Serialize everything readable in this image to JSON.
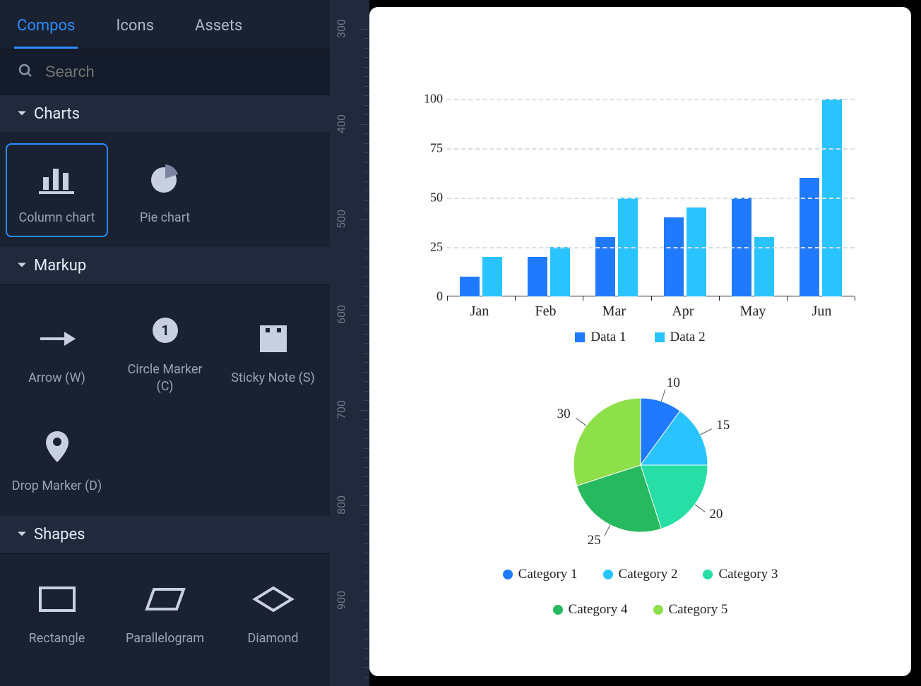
{
  "tabs": [
    "Compos",
    "Icons",
    "Assets"
  ],
  "active_tab": 0,
  "search": {
    "placeholder": "Search"
  },
  "sections": {
    "charts": {
      "title": "Charts",
      "items": [
        {
          "label": "Column chart",
          "icon": "column-chart",
          "selected": true
        },
        {
          "label": "Pie chart",
          "icon": "pie-chart",
          "selected": false
        }
      ]
    },
    "markup": {
      "title": "Markup",
      "items": [
        {
          "label": "Arrow (W)",
          "icon": "arrow"
        },
        {
          "label": "Circle Marker (C)",
          "icon": "circle-marker"
        },
        {
          "label": "Sticky Note (S)",
          "icon": "sticky-note"
        },
        {
          "label": "Drop Marker (D)",
          "icon": "drop-marker"
        }
      ]
    },
    "shapes": {
      "title": "Shapes",
      "items": [
        {
          "label": "Rectangle",
          "icon": "rectangle"
        },
        {
          "label": "Parallelogram",
          "icon": "parallelogram"
        },
        {
          "label": "Diamond",
          "icon": "diamond"
        }
      ]
    }
  },
  "ruler": {
    "start": 300,
    "end": 960,
    "step": 100
  },
  "chart_data": [
    {
      "type": "bar",
      "categories": [
        "Jan",
        "Feb",
        "Mar",
        "Apr",
        "May",
        "Jun"
      ],
      "series": [
        {
          "name": "Data 1",
          "color": "#1f7aff",
          "values": [
            10,
            20,
            30,
            40,
            50,
            60
          ]
        },
        {
          "name": "Data 2",
          "color": "#29c4ff",
          "values": [
            20,
            25,
            50,
            45,
            30,
            100
          ]
        }
      ],
      "ylim": [
        0,
        100
      ],
      "yticks": [
        0,
        25,
        50,
        75,
        100
      ]
    },
    {
      "type": "pie",
      "slices": [
        {
          "label": "Category 1",
          "value": 10,
          "color": "#1f7aff"
        },
        {
          "label": "Category 2",
          "value": 15,
          "color": "#29c4ff"
        },
        {
          "label": "Category 3",
          "value": 20,
          "color": "#27dfa6"
        },
        {
          "label": "Category 4",
          "value": 25,
          "color": "#27b95f"
        },
        {
          "label": "Category 5",
          "value": 30,
          "color": "#8ee04a"
        }
      ]
    }
  ]
}
